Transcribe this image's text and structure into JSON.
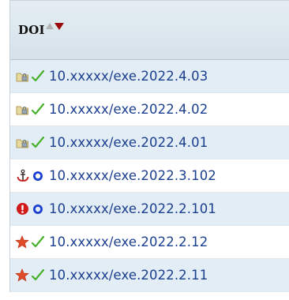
{
  "table": {
    "header": {
      "label": "DOI"
    },
    "rows": [
      {
        "doi": "10.xxxxx/exe.2022.4.03",
        "status_icon": "folder-lock-icon",
        "check_icon": "green-check-icon"
      },
      {
        "doi": "10.xxxxx/exe.2022.4.02",
        "status_icon": "folder-lock-icon",
        "check_icon": "green-check-icon"
      },
      {
        "doi": "10.xxxxx/exe.2022.4.01",
        "status_icon": "folder-lock-icon",
        "check_icon": "green-check-icon"
      },
      {
        "doi": "10.xxxxx/exe.2022.3.102",
        "status_icon": "anchor-icon",
        "check_icon": "blue-circle-icon"
      },
      {
        "doi": "10.xxxxx/exe.2022.2.101",
        "status_icon": "error-icon",
        "check_icon": "blue-circle-icon"
      },
      {
        "doi": "10.xxxxx/exe.2022.2.12",
        "status_icon": "star-icon",
        "check_icon": "green-check-icon"
      },
      {
        "doi": "10.xxxxx/exe.2022.2.11",
        "status_icon": "star-icon",
        "check_icon": "green-check-icon"
      }
    ]
  },
  "colors": {
    "link": "#1b3f8f",
    "row_alt": "#e3edf6",
    "header_bg": "#dbe6ee",
    "sort_active": "#9b0b0b",
    "check": "#46b02a",
    "circle": "#1a3fd1",
    "error": "#d11a1a",
    "star": "#e04b2a"
  }
}
